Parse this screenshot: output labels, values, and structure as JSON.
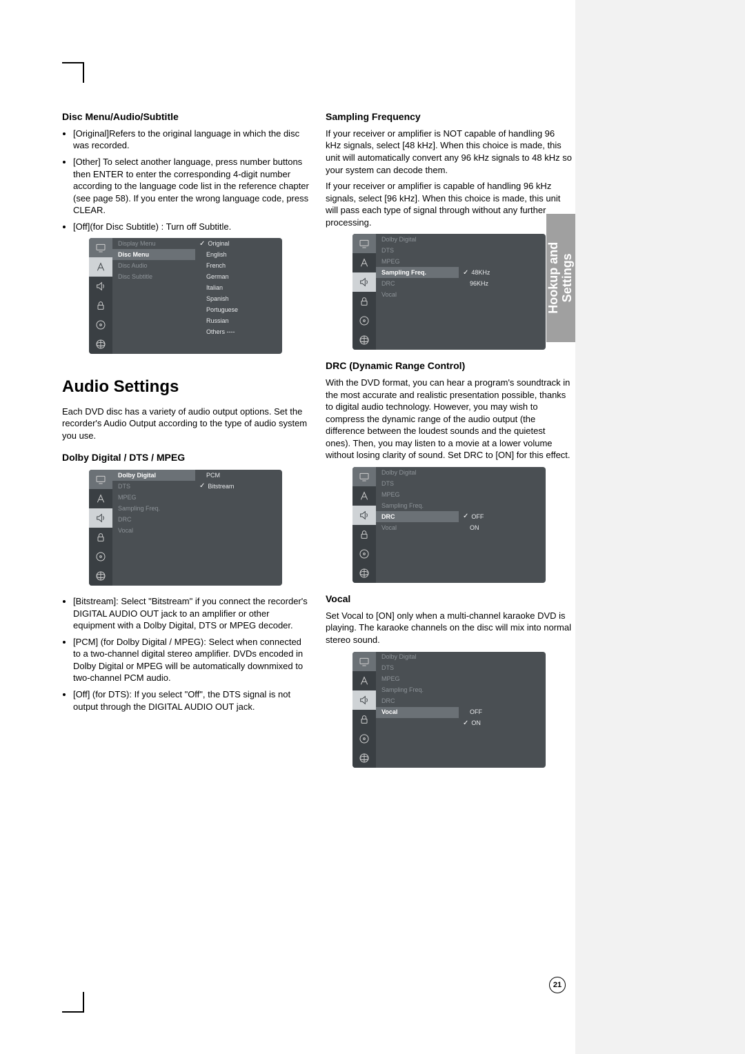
{
  "side_tab": {
    "line1": "Hookup and",
    "line2": "Settings"
  },
  "page_number": "21",
  "left": {
    "disc_heading": "Disc Menu/Audio/Subtitle",
    "disc_bullets": [
      "[Original]Refers to the original language in which the disc was recorded.",
      "[Other] To select another language, press number buttons then ENTER to enter the corresponding 4-digit number according to the language code list in the reference chapter (see page 58). If you enter the wrong language code, press CLEAR.",
      "[Off](for Disc Subtitle) : Turn off Subtitle."
    ],
    "audio_heading": "Audio Settings",
    "audio_intro": "Each DVD disc has a variety of audio output options. Set the recorder's Audio Output according to the type of audio system you use.",
    "dolby_heading": "Dolby Digital / DTS / MPEG",
    "dolby_bullets": [
      "[Bitstream]: Select \"Bitstream\" if you connect the recorder's DIGITAL AUDIO OUT jack to an amplifier or other equipment with a Dolby Digital, DTS or MPEG decoder.",
      "[PCM] (for Dolby Digital / MPEG): Select when connected to a two-channel digital stereo amplifier. DVDs encoded in Dolby Digital or MPEG will be automatically downmixed to two-channel PCM audio.",
      "[Off] (for DTS): If you select \"Off\", the DTS signal is not output through the DIGITAL AUDIO OUT jack."
    ]
  },
  "right": {
    "sampling_heading": "Sampling Frequency",
    "sampling_p1": "If your receiver or amplifier is NOT capable of handling 96 kHz signals, select [48 kHz]. When this choice is made, this unit will automatically convert any 96 kHz signals to 48 kHz so your system can decode them.",
    "sampling_p2": "If your receiver or amplifier is capable of handling 96 kHz signals, select [96 kHz]. When this choice is made, this unit will pass each type of signal through without any further processing.",
    "drc_heading": "DRC (Dynamic Range Control)",
    "drc_p": "With the DVD format, you can hear a program's soundtrack in the most accurate and realistic presentation possible, thanks to digital audio technology. However, you may wish to compress the dynamic range of the audio output (the difference between the loudest sounds and the quietest ones). Then, you may listen to a movie at a lower volume without losing clarity of sound. Set DRC to [ON] for this effect.",
    "vocal_heading": "Vocal",
    "vocal_p": "Set Vocal to [ON] only when a multi-channel karaoke DVD is playing. The karaoke channels on the disc will mix into normal stereo sound."
  },
  "osds": {
    "disc": {
      "mid": [
        {
          "label": "Display Menu",
          "state": "dim"
        },
        {
          "label": "Disc Menu",
          "state": "selected"
        },
        {
          "label": "Disc Audio",
          "state": "dim"
        },
        {
          "label": "Disc Subtitle",
          "state": "dim"
        }
      ],
      "right": [
        {
          "label": "Original",
          "sel": true
        },
        {
          "label": "English",
          "sel": false
        },
        {
          "label": "French",
          "sel": false
        },
        {
          "label": "German",
          "sel": false
        },
        {
          "label": "Italian",
          "sel": false
        },
        {
          "label": "Spanish",
          "sel": false
        },
        {
          "label": "Portuguese",
          "sel": false
        },
        {
          "label": "Russian",
          "sel": false
        },
        {
          "label": "Others    ----",
          "sel": false
        }
      ],
      "hl_icon_index": 1
    },
    "dolby": {
      "mid": [
        {
          "label": "Dolby Digital",
          "state": "selected"
        },
        {
          "label": "DTS",
          "state": "dim"
        },
        {
          "label": "MPEG",
          "state": "dim"
        },
        {
          "label": "Sampling Freq.",
          "state": "dim"
        },
        {
          "label": "DRC",
          "state": "dim"
        },
        {
          "label": "Vocal",
          "state": "dim"
        }
      ],
      "right": [
        {
          "label": "PCM",
          "sel": false
        },
        {
          "label": "Bitstream",
          "sel": true
        }
      ],
      "hl_icon_index": 2
    },
    "sampling": {
      "mid": [
        {
          "label": "Dolby Digital",
          "state": "dim"
        },
        {
          "label": "DTS",
          "state": "dim"
        },
        {
          "label": "MPEG",
          "state": "dim"
        },
        {
          "label": "Sampling Freq.",
          "state": "selected"
        },
        {
          "label": "DRC",
          "state": "dim"
        },
        {
          "label": "Vocal",
          "state": "dim"
        }
      ],
      "right_pad_before": 3,
      "right": [
        {
          "label": "48KHz",
          "sel": true
        },
        {
          "label": "96KHz",
          "sel": false
        }
      ],
      "hl_icon_index": 2
    },
    "drc": {
      "mid": [
        {
          "label": "Dolby Digital",
          "state": "dim"
        },
        {
          "label": "DTS",
          "state": "dim"
        },
        {
          "label": "MPEG",
          "state": "dim"
        },
        {
          "label": "Sampling Freq.",
          "state": "dim"
        },
        {
          "label": "DRC",
          "state": "selected"
        },
        {
          "label": "Vocal",
          "state": "dim"
        }
      ],
      "right_pad_before": 4,
      "right": [
        {
          "label": "OFF",
          "sel": true
        },
        {
          "label": "ON",
          "sel": false
        }
      ],
      "hl_icon_index": 2
    },
    "vocal": {
      "mid": [
        {
          "label": "Dolby Digital",
          "state": "dim"
        },
        {
          "label": "DTS",
          "state": "dim"
        },
        {
          "label": "MPEG",
          "state": "dim"
        },
        {
          "label": "Sampling Freq.",
          "state": "dim"
        },
        {
          "label": "DRC",
          "state": "dim"
        },
        {
          "label": "Vocal",
          "state": "selected"
        }
      ],
      "right_pad_before": 5,
      "right": [
        {
          "label": "OFF",
          "sel": false
        },
        {
          "label": "ON",
          "sel": true
        }
      ],
      "hl_icon_index": 2
    }
  }
}
